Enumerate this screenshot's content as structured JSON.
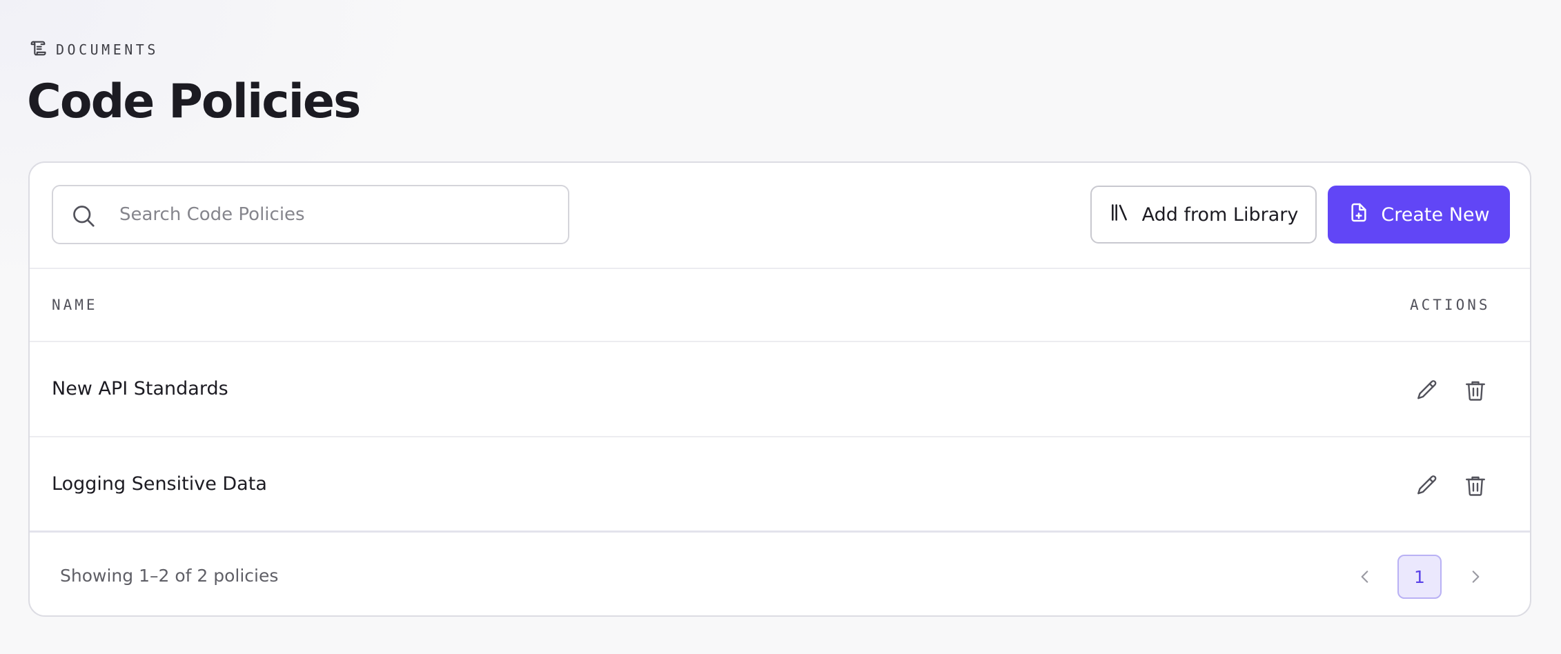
{
  "header": {
    "eyebrow_icon": "scroll-icon",
    "eyebrow": "DOCUMENTS",
    "title": "Code Policies"
  },
  "toolbar": {
    "search_placeholder": "Search Code Policies",
    "search_value": "",
    "search_icon": "search-icon",
    "add_library_label": "Add from Library",
    "add_library_icon": "library-icon",
    "create_new_label": "Create New",
    "create_new_icon": "file-plus-icon",
    "accent_color": "#6146f6"
  },
  "table": {
    "columns": [
      "NAME",
      "ACTIONS"
    ],
    "rows": [
      {
        "name": "New API Standards",
        "actions": [
          "pencil-icon",
          "trash-icon"
        ]
      },
      {
        "name": "Logging Sensitive Data",
        "actions": [
          "pencil-icon",
          "trash-icon"
        ]
      }
    ]
  },
  "footer": {
    "showing": "Showing 1–2 of 2 policies",
    "current_page": "1",
    "prev_icon": "chevron-left-icon",
    "next_icon": "chevron-right-icon"
  }
}
